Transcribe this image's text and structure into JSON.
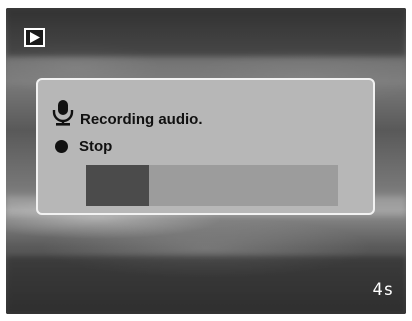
{
  "mode_indicator": {
    "icon": "playback-mode-icon"
  },
  "recording_dialog": {
    "title_icon": "microphone-icon",
    "title": "Recording audio.",
    "stop_icon": "record-dot-icon",
    "stop_label": "Stop",
    "progress_fraction": 0.25,
    "colors": {
      "panel": "#b7b7b7",
      "track": "#9c9c9c",
      "fill": "#4b4b4b"
    }
  },
  "elapsed_time": "4s"
}
